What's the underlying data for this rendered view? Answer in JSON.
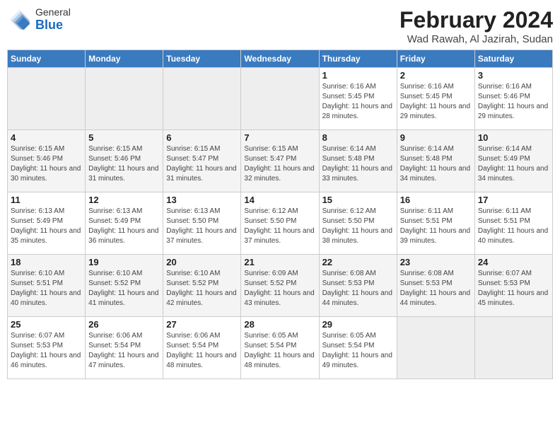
{
  "header": {
    "logo_general": "General",
    "logo_blue": "Blue",
    "title": "February 2024",
    "location": "Wad Rawah, Al Jazirah, Sudan"
  },
  "weekdays": [
    "Sunday",
    "Monday",
    "Tuesday",
    "Wednesday",
    "Thursday",
    "Friday",
    "Saturday"
  ],
  "weeks": [
    [
      {
        "day": "",
        "empty": true
      },
      {
        "day": "",
        "empty": true
      },
      {
        "day": "",
        "empty": true
      },
      {
        "day": "",
        "empty": true
      },
      {
        "day": "1",
        "sunrise": "6:16 AM",
        "sunset": "5:45 PM",
        "daylight": "11 hours and 28 minutes."
      },
      {
        "day": "2",
        "sunrise": "6:16 AM",
        "sunset": "5:45 PM",
        "daylight": "11 hours and 29 minutes."
      },
      {
        "day": "3",
        "sunrise": "6:16 AM",
        "sunset": "5:46 PM",
        "daylight": "11 hours and 29 minutes."
      }
    ],
    [
      {
        "day": "4",
        "sunrise": "6:15 AM",
        "sunset": "5:46 PM",
        "daylight": "11 hours and 30 minutes."
      },
      {
        "day": "5",
        "sunrise": "6:15 AM",
        "sunset": "5:46 PM",
        "daylight": "11 hours and 31 minutes."
      },
      {
        "day": "6",
        "sunrise": "6:15 AM",
        "sunset": "5:47 PM",
        "daylight": "11 hours and 31 minutes."
      },
      {
        "day": "7",
        "sunrise": "6:15 AM",
        "sunset": "5:47 PM",
        "daylight": "11 hours and 32 minutes."
      },
      {
        "day": "8",
        "sunrise": "6:14 AM",
        "sunset": "5:48 PM",
        "daylight": "11 hours and 33 minutes."
      },
      {
        "day": "9",
        "sunrise": "6:14 AM",
        "sunset": "5:48 PM",
        "daylight": "11 hours and 34 minutes."
      },
      {
        "day": "10",
        "sunrise": "6:14 AM",
        "sunset": "5:49 PM",
        "daylight": "11 hours and 34 minutes."
      }
    ],
    [
      {
        "day": "11",
        "sunrise": "6:13 AM",
        "sunset": "5:49 PM",
        "daylight": "11 hours and 35 minutes."
      },
      {
        "day": "12",
        "sunrise": "6:13 AM",
        "sunset": "5:49 PM",
        "daylight": "11 hours and 36 minutes."
      },
      {
        "day": "13",
        "sunrise": "6:13 AM",
        "sunset": "5:50 PM",
        "daylight": "11 hours and 37 minutes."
      },
      {
        "day": "14",
        "sunrise": "6:12 AM",
        "sunset": "5:50 PM",
        "daylight": "11 hours and 37 minutes."
      },
      {
        "day": "15",
        "sunrise": "6:12 AM",
        "sunset": "5:50 PM",
        "daylight": "11 hours and 38 minutes."
      },
      {
        "day": "16",
        "sunrise": "6:11 AM",
        "sunset": "5:51 PM",
        "daylight": "11 hours and 39 minutes."
      },
      {
        "day": "17",
        "sunrise": "6:11 AM",
        "sunset": "5:51 PM",
        "daylight": "11 hours and 40 minutes."
      }
    ],
    [
      {
        "day": "18",
        "sunrise": "6:10 AM",
        "sunset": "5:51 PM",
        "daylight": "11 hours and 40 minutes."
      },
      {
        "day": "19",
        "sunrise": "6:10 AM",
        "sunset": "5:52 PM",
        "daylight": "11 hours and 41 minutes."
      },
      {
        "day": "20",
        "sunrise": "6:10 AM",
        "sunset": "5:52 PM",
        "daylight": "11 hours and 42 minutes."
      },
      {
        "day": "21",
        "sunrise": "6:09 AM",
        "sunset": "5:52 PM",
        "daylight": "11 hours and 43 minutes."
      },
      {
        "day": "22",
        "sunrise": "6:08 AM",
        "sunset": "5:53 PM",
        "daylight": "11 hours and 44 minutes."
      },
      {
        "day": "23",
        "sunrise": "6:08 AM",
        "sunset": "5:53 PM",
        "daylight": "11 hours and 44 minutes."
      },
      {
        "day": "24",
        "sunrise": "6:07 AM",
        "sunset": "5:53 PM",
        "daylight": "11 hours and 45 minutes."
      }
    ],
    [
      {
        "day": "25",
        "sunrise": "6:07 AM",
        "sunset": "5:53 PM",
        "daylight": "11 hours and 46 minutes."
      },
      {
        "day": "26",
        "sunrise": "6:06 AM",
        "sunset": "5:54 PM",
        "daylight": "11 hours and 47 minutes."
      },
      {
        "day": "27",
        "sunrise": "6:06 AM",
        "sunset": "5:54 PM",
        "daylight": "11 hours and 48 minutes."
      },
      {
        "day": "28",
        "sunrise": "6:05 AM",
        "sunset": "5:54 PM",
        "daylight": "11 hours and 48 minutes."
      },
      {
        "day": "29",
        "sunrise": "6:05 AM",
        "sunset": "5:54 PM",
        "daylight": "11 hours and 49 minutes."
      },
      {
        "day": "",
        "empty": true
      },
      {
        "day": "",
        "empty": true
      }
    ]
  ]
}
